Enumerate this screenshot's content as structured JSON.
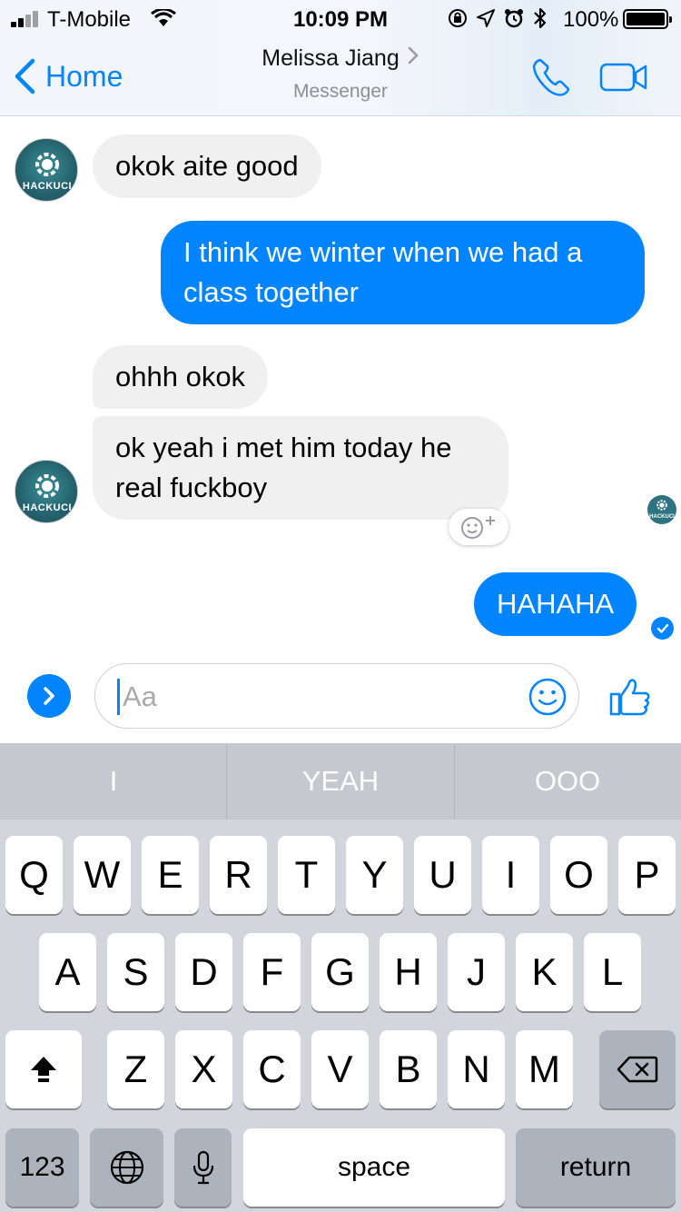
{
  "status_bar": {
    "carrier": "T-Mobile",
    "time": "10:09 PM",
    "battery_percent": "100%"
  },
  "header": {
    "back_label": "Home",
    "contact_name": "Melissa Jiang",
    "subtitle": "Messenger"
  },
  "messages": [
    {
      "direction": "incoming",
      "text": "okok aite good"
    },
    {
      "direction": "outgoing",
      "text": "I think we winter when we had a class together"
    },
    {
      "direction": "incoming",
      "text": "ohhh okok"
    },
    {
      "direction": "incoming",
      "text": "ok yeah i met him today he real fuckboy"
    },
    {
      "direction": "outgoing",
      "text": "HAHAHA"
    }
  ],
  "avatar_text": "HACKUCI",
  "composer": {
    "placeholder": "Aa"
  },
  "keyboard": {
    "predictions": [
      "I",
      "YEAH",
      "OOO"
    ],
    "row1": [
      "Q",
      "W",
      "E",
      "R",
      "T",
      "Y",
      "U",
      "I",
      "O",
      "P"
    ],
    "row2": [
      "A",
      "S",
      "D",
      "F",
      "G",
      "H",
      "J",
      "K",
      "L"
    ],
    "row3": [
      "Z",
      "X",
      "C",
      "V",
      "B",
      "N",
      "M"
    ],
    "numbers_label": "123",
    "space_label": "space",
    "return_label": "return"
  },
  "colors": {
    "accent": "#0084ff",
    "incoming_bubble": "#f1f0f0",
    "keyboard_bg": "#d2d5db"
  }
}
